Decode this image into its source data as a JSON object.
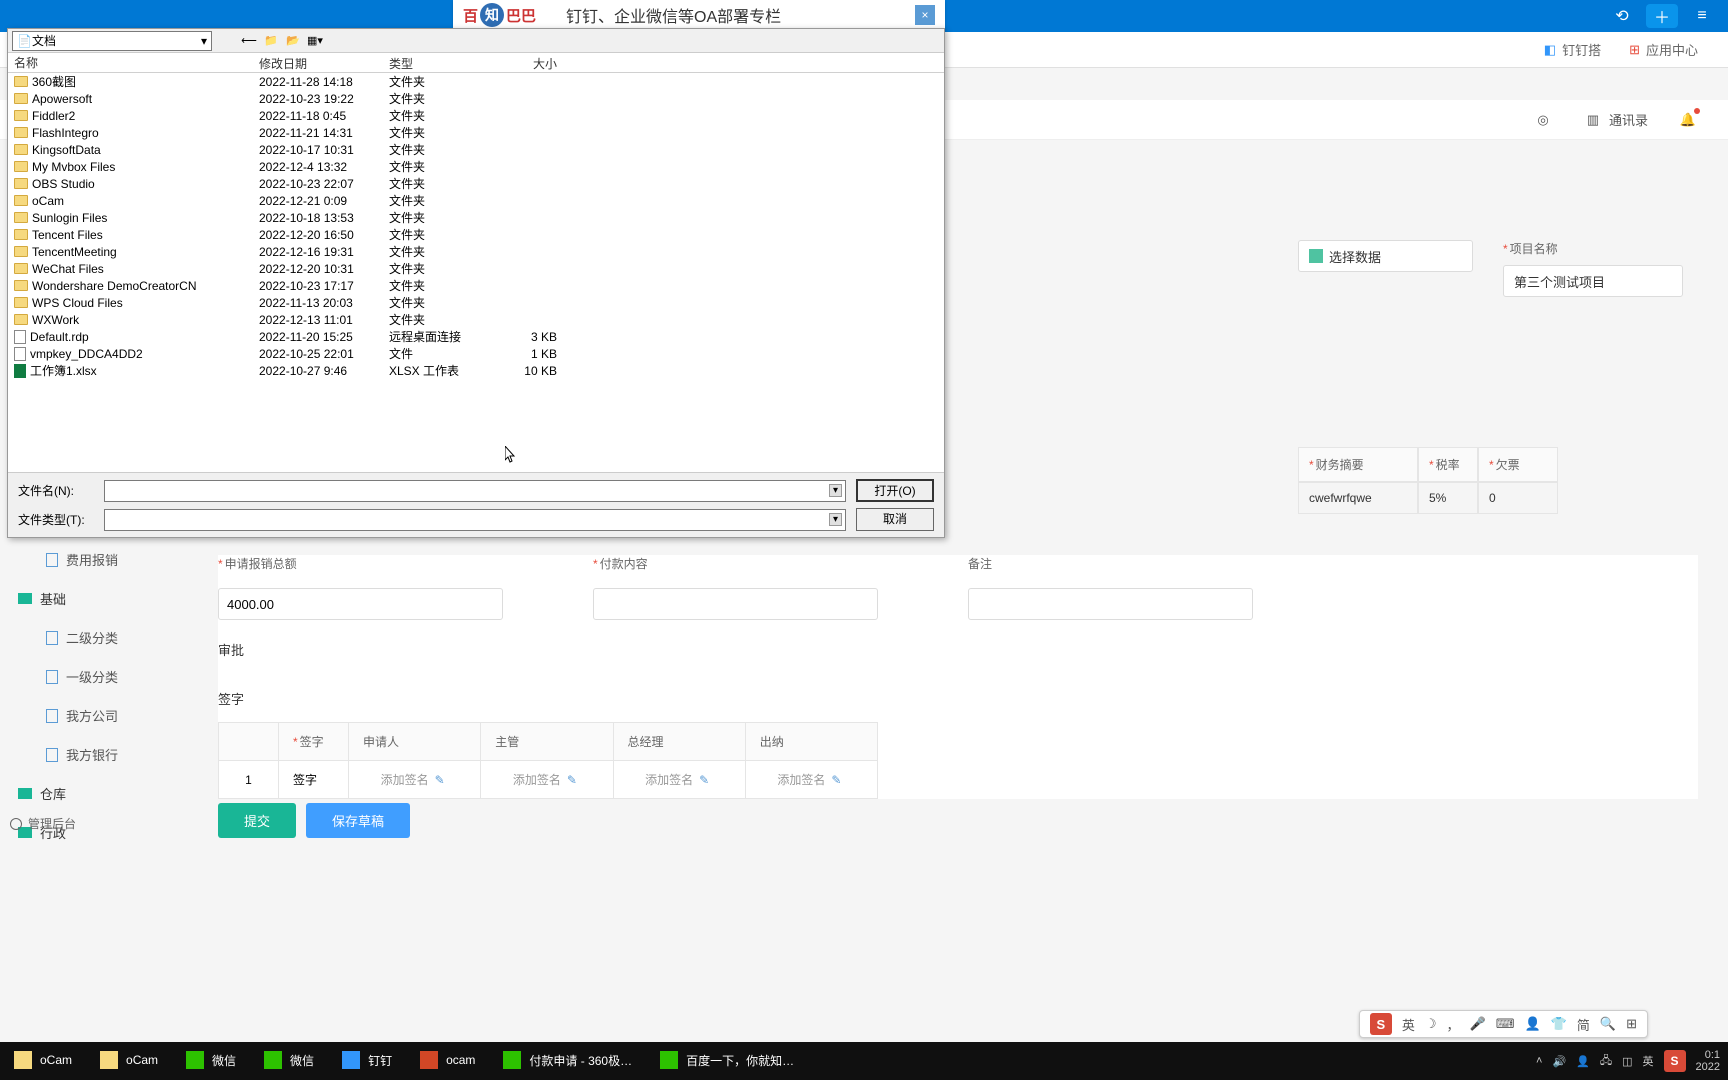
{
  "browser": {
    "history_icon": "⟲",
    "new_tab": "＋"
  },
  "browserBar": {
    "dingding": "钉钉搭",
    "appcenter": "应用中心"
  },
  "banner": {
    "logo1": "百",
    "logo2": "知",
    "logo3": "巴巴",
    "text": "钉钉、企业微信等OA部署专栏",
    "close": "×"
  },
  "appHeader": {
    "contacts": "通讯录"
  },
  "fileDialog": {
    "pathIcon": "📄",
    "path": "文档",
    "cols": {
      "name": "名称",
      "date": "修改日期",
      "type": "类型",
      "size": "大小"
    },
    "rows": [
      {
        "icon": "folder",
        "name": "360截图",
        "date": "2022-11-28 14:18",
        "type": "文件夹",
        "size": ""
      },
      {
        "icon": "folder",
        "name": "Apowersoft",
        "date": "2022-10-23 19:22",
        "type": "文件夹",
        "size": ""
      },
      {
        "icon": "folder",
        "name": "Fiddler2",
        "date": "2022-11-18 0:45",
        "type": "文件夹",
        "size": ""
      },
      {
        "icon": "folder",
        "name": "FlashIntegro",
        "date": "2022-11-21 14:31",
        "type": "文件夹",
        "size": ""
      },
      {
        "icon": "folder",
        "name": "KingsoftData",
        "date": "2022-10-17 10:31",
        "type": "文件夹",
        "size": ""
      },
      {
        "icon": "folder",
        "name": "My Mvbox Files",
        "date": "2022-12-4 13:32",
        "type": "文件夹",
        "size": ""
      },
      {
        "icon": "folder",
        "name": "OBS Studio",
        "date": "2022-10-23 22:07",
        "type": "文件夹",
        "size": ""
      },
      {
        "icon": "folder",
        "name": "oCam",
        "date": "2022-12-21 0:09",
        "type": "文件夹",
        "size": ""
      },
      {
        "icon": "folder",
        "name": "Sunlogin Files",
        "date": "2022-10-18 13:53",
        "type": "文件夹",
        "size": ""
      },
      {
        "icon": "folder",
        "name": "Tencent Files",
        "date": "2022-12-20 16:50",
        "type": "文件夹",
        "size": ""
      },
      {
        "icon": "folder",
        "name": "TencentMeeting",
        "date": "2022-12-16 19:31",
        "type": "文件夹",
        "size": ""
      },
      {
        "icon": "folder",
        "name": "WeChat Files",
        "date": "2022-12-20 10:31",
        "type": "文件夹",
        "size": ""
      },
      {
        "icon": "folder",
        "name": "Wondershare DemoCreatorCN",
        "date": "2022-10-23 17:17",
        "type": "文件夹",
        "size": ""
      },
      {
        "icon": "folder",
        "name": "WPS Cloud Files",
        "date": "2022-11-13 20:03",
        "type": "文件夹",
        "size": ""
      },
      {
        "icon": "folder",
        "name": "WXWork",
        "date": "2022-12-13 11:01",
        "type": "文件夹",
        "size": ""
      },
      {
        "icon": "file",
        "name": "Default.rdp",
        "date": "2022-11-20 15:25",
        "type": "远程桌面连接",
        "size": "3 KB"
      },
      {
        "icon": "file",
        "name": "vmpkey_DDCA4DD2",
        "date": "2022-10-25 22:01",
        "type": "文件",
        "size": "1 KB"
      },
      {
        "icon": "xlsx",
        "name": "工作簿1.xlsx",
        "date": "2022-10-27 9:46",
        "type": "XLSX 工作表",
        "size": "10 KB"
      }
    ],
    "fileNameLabel": "文件名(N):",
    "fileTypeLabel": "文件类型(T):",
    "open": "打开(O)",
    "cancel": "取消"
  },
  "rightPanel": {
    "projectNameLabel": "项目名称",
    "selectData": "选择数据",
    "projectName": "第三个测试项目",
    "finSummary": "财务摘要",
    "taxRate": "税率",
    "owed": "欠票",
    "finSummaryVal": "cwefwrfqwe",
    "taxRateVal": "5%",
    "owedVal": "0"
  },
  "form": {
    "totalLabel": "申请报销总额",
    "totalValue": "4000.00",
    "payContentLabel": "付款内容",
    "remarkLabel": "备注",
    "approval": "审批",
    "signature": "签字",
    "sigCols": {
      "idx": "",
      "sig": "签字",
      "applicant": "申请人",
      "supervisor": "主管",
      "gm": "总经理",
      "cashier": "出纳"
    },
    "sigRow": {
      "idx": "1",
      "sig": "签字",
      "add": "添加签名"
    },
    "submit": "提交",
    "saveDraft": "保存草稿"
  },
  "sidebar": {
    "expense": "费用报销",
    "basic": "基础",
    "level2": "二级分类",
    "level1": "一级分类",
    "ourCompany": "我方公司",
    "ourBank": "我方银行",
    "warehouse": "仓库",
    "admin": "行政",
    "mgmt": "管理后台"
  },
  "taskbar": {
    "items": [
      {
        "name": "oCam",
        "color": "#f6d97f"
      },
      {
        "name": "oCam",
        "color": "#f6d97f"
      },
      {
        "name": "微信",
        "color": "#2dc100"
      },
      {
        "name": "微信",
        "color": "#2dc100"
      },
      {
        "name": "钉钉",
        "color": "#3296fa"
      },
      {
        "name": "ocam",
        "color": "#d24726"
      },
      {
        "name": "付款申请 - 360极…",
        "color": "#2dc100"
      },
      {
        "name": "百度一下，你就知…",
        "color": "#2dc100"
      }
    ],
    "ime": "英",
    "time": "0:1",
    "date": "2022"
  },
  "ime": {
    "tile": "S",
    "lang": "英",
    "mode": "简"
  }
}
